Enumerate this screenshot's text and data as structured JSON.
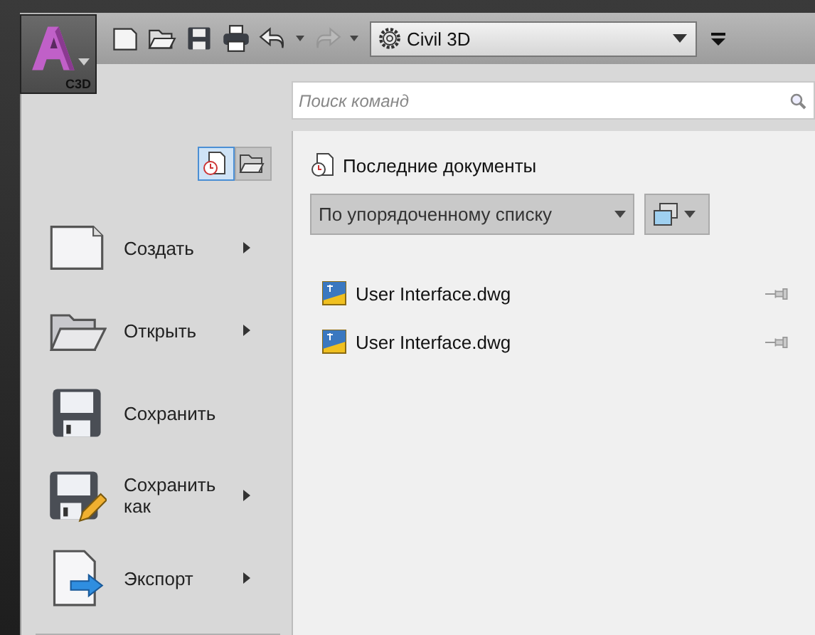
{
  "app_button": {
    "label": "C3D"
  },
  "quick_access": [
    {
      "kind": "new",
      "disabled": false
    },
    {
      "kind": "open",
      "disabled": false
    },
    {
      "kind": "save",
      "disabled": false
    },
    {
      "kind": "print",
      "disabled": false
    },
    {
      "kind": "undo",
      "disabled": false
    },
    {
      "kind": "redo",
      "disabled": true
    }
  ],
  "workspace": {
    "value": "Civil 3D"
  },
  "search": {
    "placeholder": "Поиск команд"
  },
  "view_toggle": [
    {
      "kind": "recent",
      "selected": true
    },
    {
      "kind": "open",
      "selected": false
    }
  ],
  "menu": [
    {
      "kind": "new",
      "label": "Создать",
      "submenu": true
    },
    {
      "kind": "open",
      "label": "Открыть",
      "submenu": true
    },
    {
      "kind": "save",
      "label": "Сохранить",
      "submenu": false
    },
    {
      "kind": "saveas",
      "label": "Сохранить как",
      "submenu": true
    },
    {
      "kind": "export",
      "label": "Экспорт",
      "submenu": true
    }
  ],
  "recent": {
    "title": "Последние документы",
    "sort": "По упорядоченному списку",
    "files": [
      {
        "name": "User Interface.dwg",
        "pinned": false
      },
      {
        "name": "User Interface.dwg",
        "pinned": false
      }
    ]
  }
}
